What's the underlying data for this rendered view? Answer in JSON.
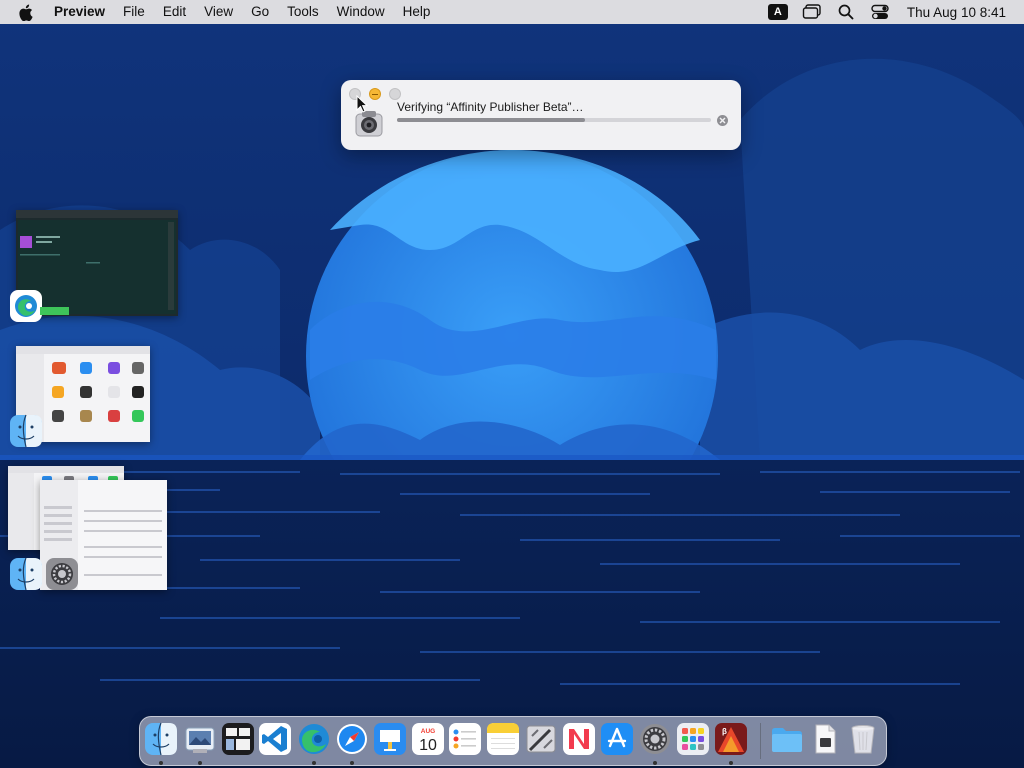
{
  "menubar": {
    "app_name": "Preview",
    "menus": [
      "File",
      "Edit",
      "View",
      "Go",
      "Tools",
      "Window",
      "Help"
    ],
    "keyboard_badge": "A",
    "clock": "Thu Aug 10  8:41",
    "status_icons": [
      "keyboard-input-icon",
      "screen-mirroring-icon",
      "spotlight-search-icon",
      "control-center-icon"
    ]
  },
  "verify_panel": {
    "message": "Verifying “Affinity Publisher Beta”…",
    "progress_percent": 60
  },
  "switcher": {
    "windows": [
      {
        "app": "Microsoft Edge",
        "icon": "edge-icon"
      },
      {
        "app": "Finder",
        "icon": "finder-icon"
      },
      {
        "app": "Finder",
        "icon": "finder-icon"
      },
      {
        "app": "System Settings",
        "icon": "settings-icon"
      }
    ]
  },
  "dock": {
    "calendar_month": "AUG",
    "calendar_day": "10",
    "items": [
      {
        "name": "Finder",
        "icon": "finder-icon",
        "running": true
      },
      {
        "name": "Preview",
        "icon": "preview-icon",
        "running": true
      },
      {
        "name": "Mission Control",
        "icon": "mission-control-icon",
        "running": false
      },
      {
        "name": "Visual Studio Code",
        "icon": "vscode-icon",
        "running": false
      },
      {
        "name": "Microsoft Edge",
        "icon": "edge-icon",
        "running": true
      },
      {
        "name": "Safari",
        "icon": "safari-icon",
        "running": true
      },
      {
        "name": "Keynote",
        "icon": "keynote-icon",
        "running": false
      },
      {
        "name": "Calendar",
        "icon": "calendar-icon",
        "running": false
      },
      {
        "name": "Reminders",
        "icon": "reminders-icon",
        "running": false
      },
      {
        "name": "Notes",
        "icon": "notes-icon",
        "running": false
      },
      {
        "name": "Script Editor",
        "icon": "script-editor-icon",
        "running": false
      },
      {
        "name": "News",
        "icon": "news-icon",
        "running": false
      },
      {
        "name": "App Store",
        "icon": "app-store-icon",
        "running": false
      },
      {
        "name": "System Settings",
        "icon": "settings-icon",
        "running": true
      },
      {
        "name": "Launchpad",
        "icon": "launchpad-icon",
        "running": false
      },
      {
        "name": "Affinity Publisher Beta",
        "icon": "affinity-publisher-icon",
        "running": true
      },
      {
        "name": "Downloads",
        "icon": "folder-icon",
        "running": false
      },
      {
        "name": "Recent Document",
        "icon": "document-icon",
        "running": false
      },
      {
        "name": "Trash",
        "icon": "trash-icon",
        "running": false
      }
    ]
  },
  "colors": {
    "wallpaper_sky": "#0d2a6b",
    "planet": "#2f8ff0",
    "panel_bg": "#f1f1f3",
    "menubar_bg": "#dcdce0"
  }
}
